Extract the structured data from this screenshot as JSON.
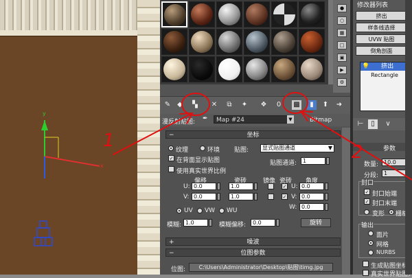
{
  "material_editor": {
    "map_label": "漫反射贴图:",
    "map_name": "Map #24",
    "map_type": "Bitmap"
  },
  "coordinates": {
    "title": "坐标",
    "texture": "纹理",
    "environ": "环境",
    "mapping_label": "贴图:",
    "mapping_value": "显式贴图通道",
    "show_back": "在背面显示贴图",
    "map_channel_label": "贴图通道:",
    "map_channel_value": "1",
    "real_world": "使用真实世界比例",
    "offset": "偏移",
    "tiling": "瓷砖",
    "mirror": "镜像",
    "tile": "瓷砖",
    "angle": "角度",
    "u_label": "U:",
    "v_label": "V:",
    "w_label": "W:",
    "u_offset": "0.0",
    "v_offset": "0.0",
    "u_tiling": "1.0",
    "v_tiling": "1.0",
    "u_angle": "0.0",
    "v_angle": "0.0",
    "w_angle": "0.0",
    "uv": "UV",
    "vw": "VW",
    "wu": "WU",
    "blur_label": "模糊:",
    "blur_value": "1.0",
    "blur_offset_label": "模糊偏移:",
    "blur_offset_value": "0.0",
    "rotate": "旋转"
  },
  "noise": {
    "title": "噪波"
  },
  "bitmap_params": {
    "title": "位图参数",
    "bitmap_label": "位图:",
    "bitmap_path": "C:\\Users\\Administrator\\Desktop\\贴图\\timg.jpg"
  },
  "command_panel": {
    "header": "修改器列表",
    "btn_extrude": "挤出",
    "btn_free_deform": "样条线选择",
    "btn_uvw": "UVW 贴图",
    "btn_bevel": "倒角剖面",
    "stack_item_1": "挤出",
    "stack_item_2": "Rectangle",
    "params_title": "参数",
    "amount_label": "数量:",
    "amount_value": "10.0",
    "segments_label": "分段:",
    "segments_value": "1",
    "cap_title": "封口",
    "cap_start": "封口始端",
    "cap_end": "封口末端",
    "morph": "变形",
    "grid": "栅格",
    "output_title": "输出",
    "out_patch": "面片",
    "out_mesh": "网格",
    "out_nurbs": "NURBS",
    "gen_map_coords": "生成贴图坐标",
    "real_world": "真实世界贴图大小"
  },
  "annotations": {
    "label_1": "1",
    "label_2": "2"
  },
  "colors": {
    "annotation_red": "#e01010",
    "wall_brown": "#6a4526",
    "panel_gray": "#545454"
  }
}
